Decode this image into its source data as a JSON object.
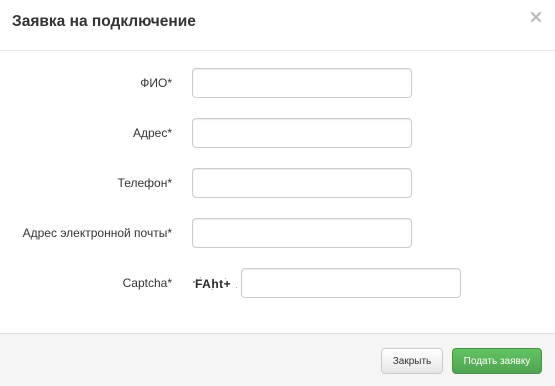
{
  "modal": {
    "title": "Заявка на подключение",
    "close_icon": "close-icon"
  },
  "form": {
    "fields": [
      {
        "label": "ФИО*",
        "value": "",
        "placeholder": ""
      },
      {
        "label": "Адрес*",
        "value": "",
        "placeholder": ""
      },
      {
        "label": "Телефон*",
        "value": "",
        "placeholder": ""
      },
      {
        "label": "Адрес электронной почты*",
        "value": "",
        "placeholder": ""
      },
      {
        "label": "Captcha*",
        "value": "",
        "placeholder": ""
      }
    ],
    "captcha_image_text": "FAht+"
  },
  "footer": {
    "close_label": "Закрыть",
    "submit_label": "Подать заявку"
  },
  "colors": {
    "submit_button": "#5bb75b",
    "footer_background": "#f5f5f5",
    "input_border": "#cccccc"
  }
}
